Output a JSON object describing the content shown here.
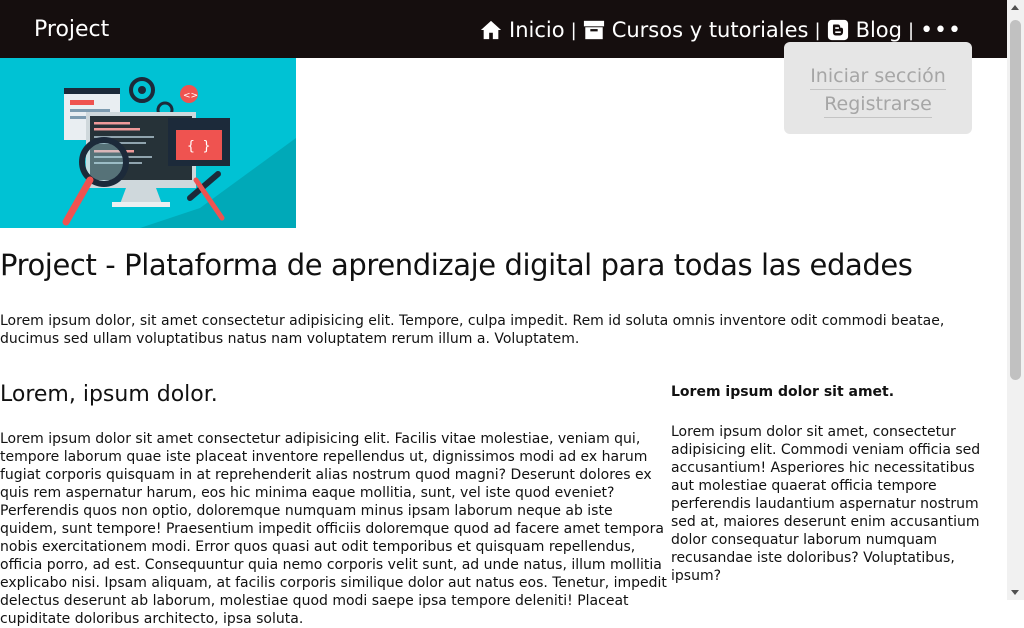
{
  "header": {
    "brand": "Project",
    "nav": {
      "inicio": "Inicio",
      "cursos": "Cursos y tutoriales",
      "blog": "Blog",
      "separator": "|",
      "more": "•••"
    }
  },
  "dropdown": {
    "login": "Iniciar sección",
    "register": "Registrarse"
  },
  "main": {
    "title": "Project - Plataforma de aprendizaje digital para todas las edades",
    "intro": "Lorem ipsum dolor, sit amet consectetur adipisicing elit. Tempore, culpa impedit. Rem id soluta omnis inventore odit commodi beatae, ducimus sed ullam voluptatibus natus nam voluptatem rerum illum a. Voluptatem.",
    "section_title": "Lorem, ipsum dolor.",
    "section_text": "Lorem ipsum dolor sit amet consectetur adipisicing elit. Facilis vitae molestiae, veniam qui, tempore laborum quae iste placeat inventore repellendus ut, dignissimos modi ad ex harum fugiat corporis quisquam in at reprehenderit alias nostrum quod magni? Deserunt dolores ex quis rem aspernatur harum, eos hic minima eaque mollitia, sunt, vel iste quod eveniet? Perferendis quos non optio, doloremque numquam minus ipsam laborum neque ab iste quidem, sunt tempore! Praesentium impedit officiis doloremque quod ad facere amet tempora nobis exercitationem modi. Error quos quasi aut odit temporibus et quisquam repellendus, officia porro, ad est. Consequuntur quia nemo corporis velit sunt, ad unde natus, illum mollitia explicabo nisi. Ipsam aliquam, at facilis corporis similique dolor aut natus eos. Tenetur, impedit delectus deserunt ab laborum, molestiae quod modi saepe ipsa tempore deleniti! Placeat cupiditate doloribus architecto, ipsa soluta."
  },
  "aside": {
    "title": "Lorem ipsum dolor sit amet.",
    "text": "Lorem ipsum dolor sit amet, consectetur adipisicing elit. Commodi veniam officia sed accusantium! Asperiores hic necessitatibus aut molestiae quaerat officia tempore perferendis laudantium aspernatur nostrum sed at, maiores deserunt enim accusantium dolor consequatur laborum numquam recusandae iste doloribus? Voluptatibus, ipsum?"
  },
  "icons": {
    "inicio": "home-icon",
    "cursos": "archive-box-icon",
    "blog": "blogger-icon",
    "more": "more-dots-icon"
  },
  "colors": {
    "header_bg": "#150e0e",
    "hero_bg": "#00c2d4",
    "dropdown_bg": "#e6e6e6",
    "dropdown_text": "#a6a6a6"
  }
}
